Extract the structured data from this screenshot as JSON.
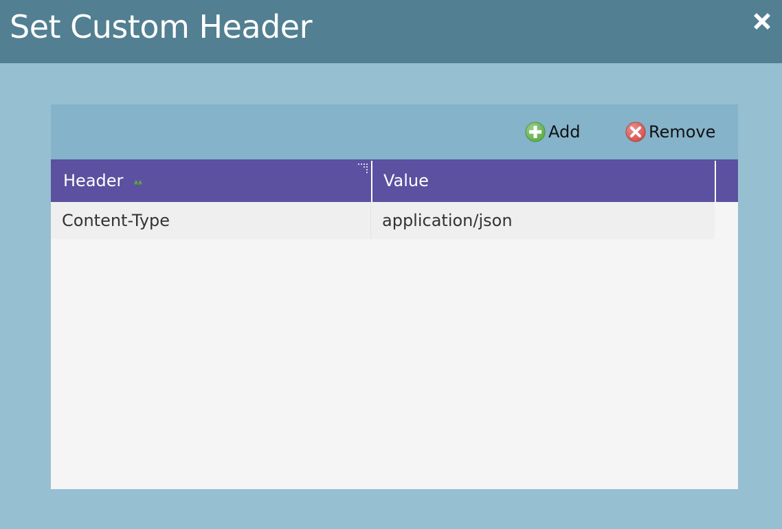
{
  "dialog": {
    "title": "Set Custom Header",
    "close_icon": "close-icon"
  },
  "toolbar": {
    "add_label": "Add",
    "add_icon": "plus-circle-icon",
    "remove_label": "Remove",
    "remove_icon": "x-circle-icon"
  },
  "grid": {
    "columns": [
      {
        "label": "Header",
        "sort_icon": "sort-indicator-icon"
      },
      {
        "label": "Value"
      }
    ],
    "rows": [
      {
        "header": "Content-Type",
        "value": "application/json"
      }
    ]
  },
  "colors": {
    "titlebar": "#527f91",
    "backdrop": "#96bfd1",
    "toolbar": "#84b3ca",
    "column_header": "#5b51a0",
    "add_green": "#5cb85c",
    "remove_red": "#d9534f"
  }
}
